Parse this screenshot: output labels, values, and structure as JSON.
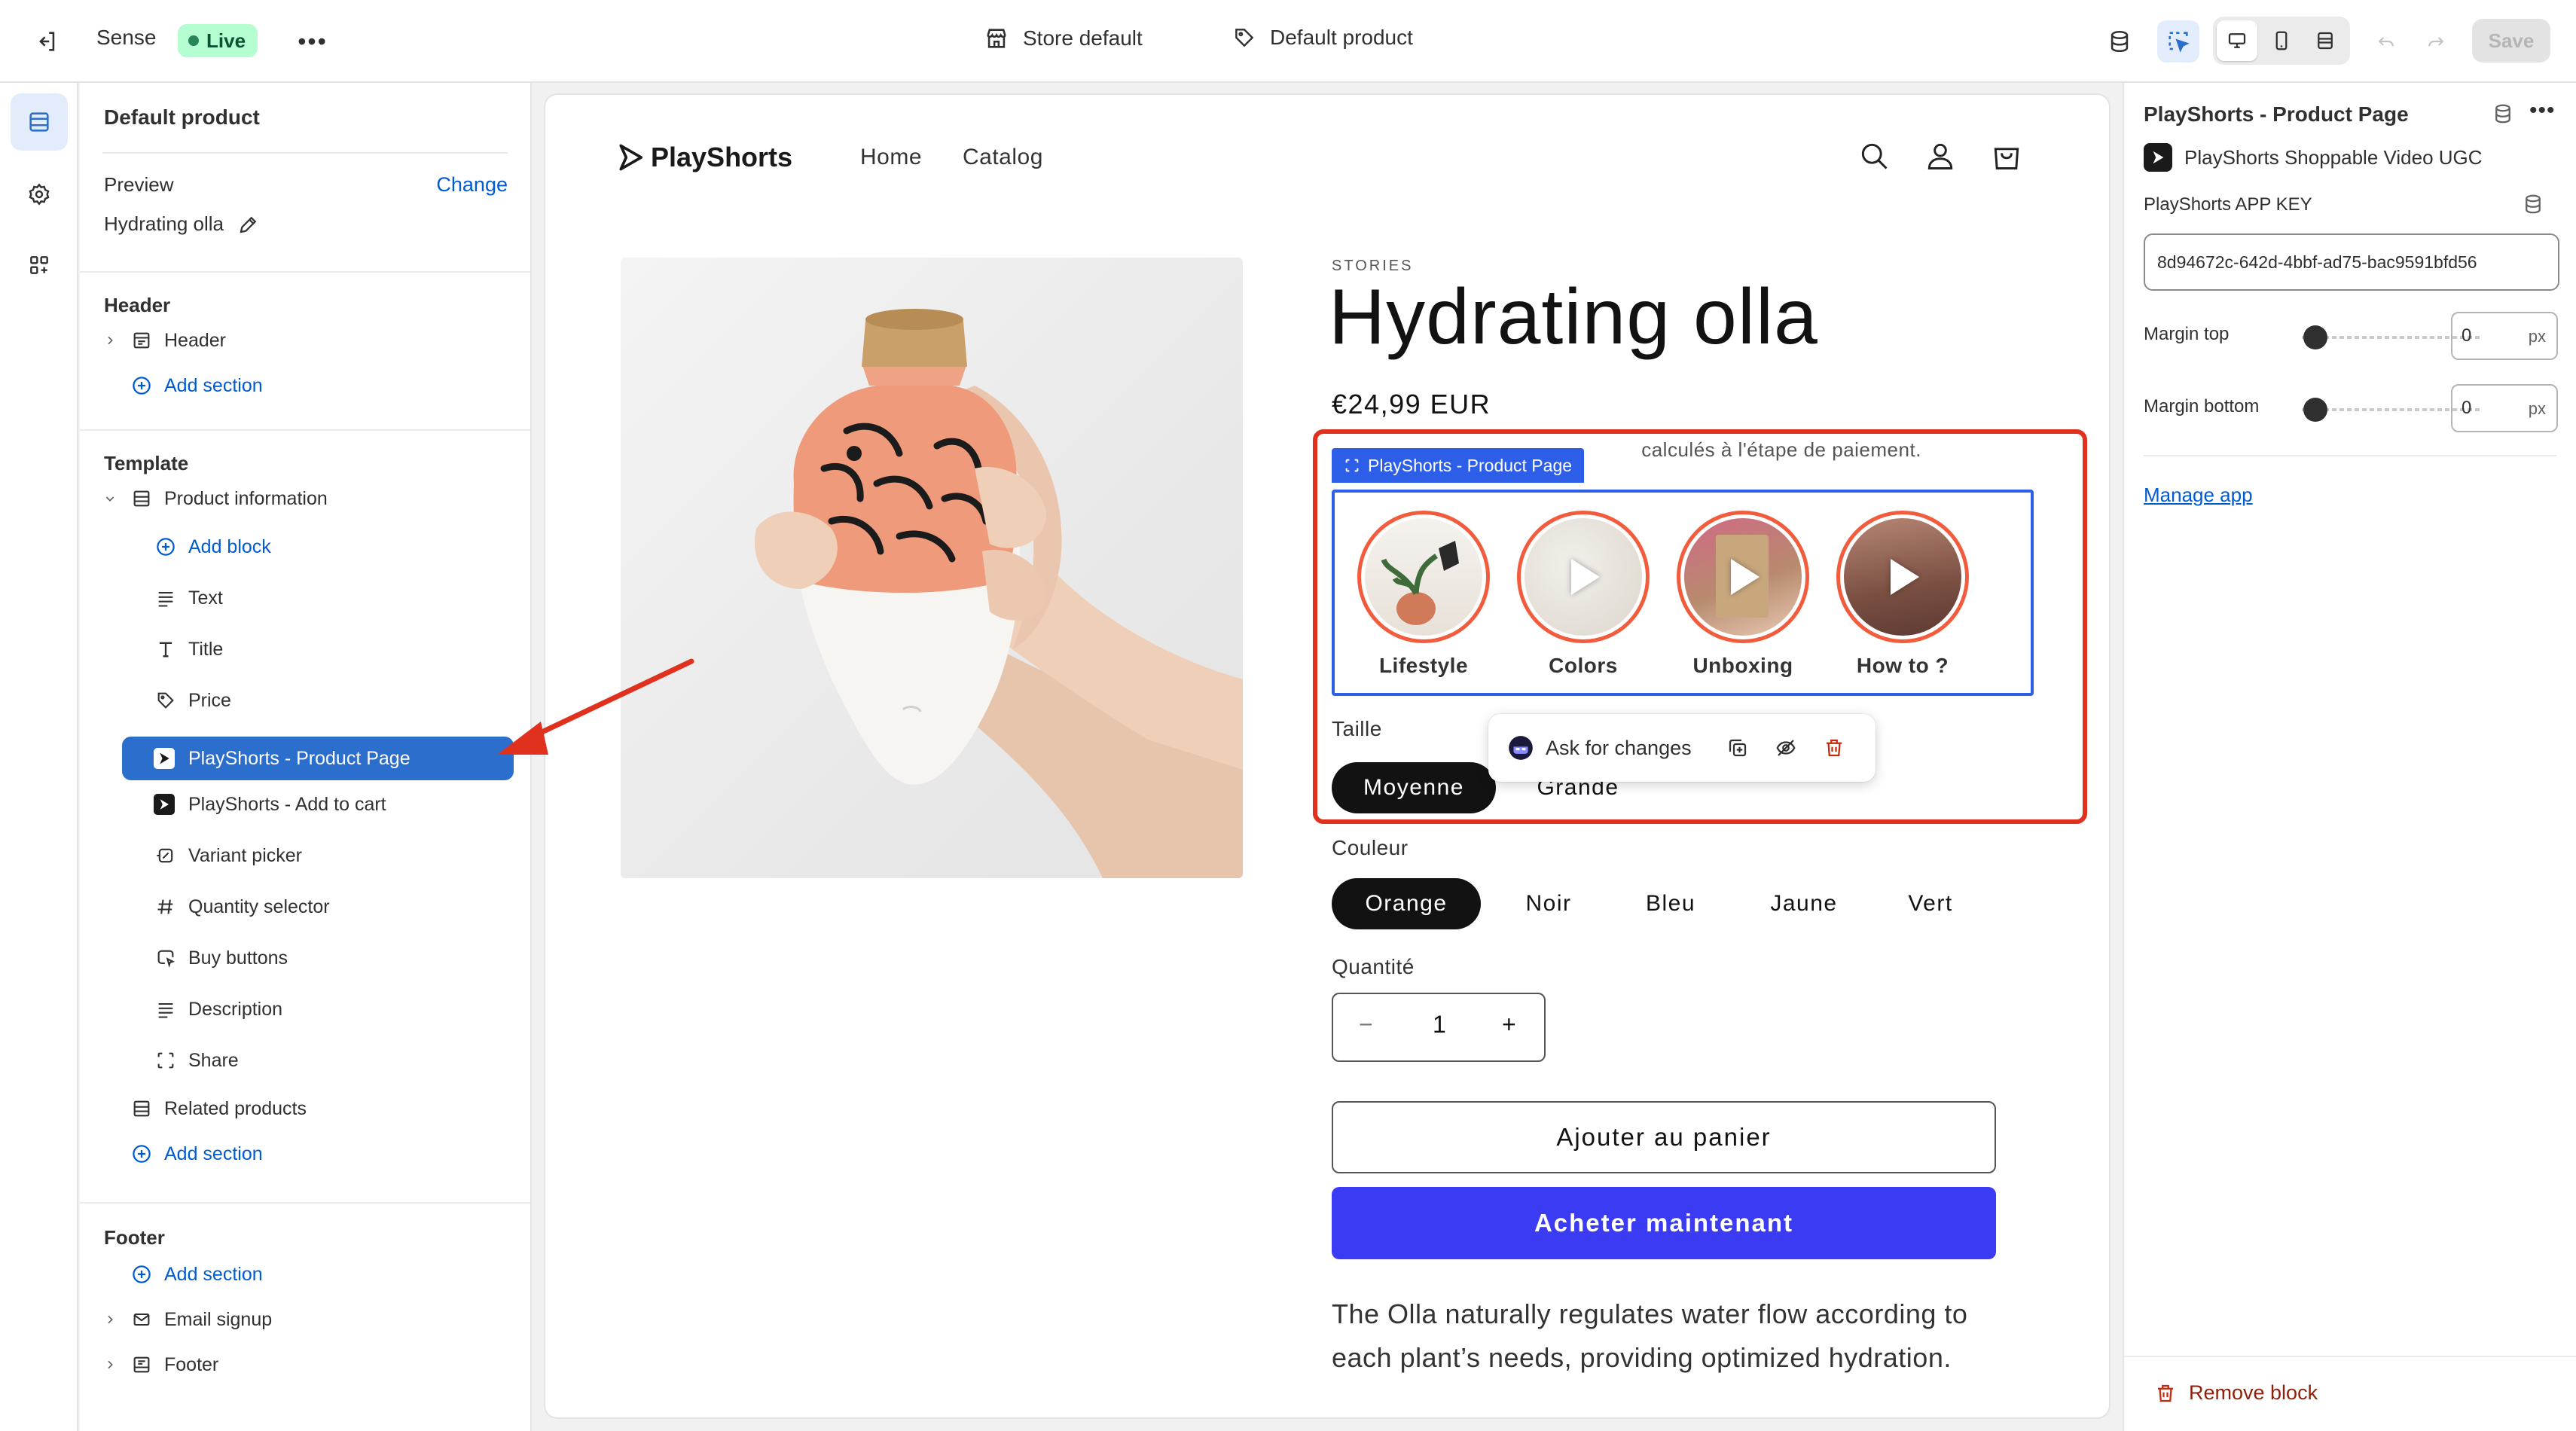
{
  "topbar": {
    "theme_name": "Sense",
    "status": "Live",
    "store_label": "Store default",
    "template_label": "Default product",
    "save_label": "Save"
  },
  "sidebar": {
    "title": "Default product",
    "preview_label": "Preview",
    "change_label": "Change",
    "preview_product": "Hydrating olla",
    "header_group": "Header",
    "header_item": "Header",
    "add_section": "Add section",
    "template_group": "Template",
    "product_information": "Product information",
    "add_block": "Add block",
    "blocks": [
      {
        "label": "Text",
        "icon": "text-icon"
      },
      {
        "label": "Title",
        "icon": "title-icon"
      },
      {
        "label": "Price",
        "icon": "price-tag-icon"
      },
      {
        "label": "PlayShorts - Product Page",
        "icon": "playshorts-app-icon",
        "selected": true
      },
      {
        "label": "PlayShorts - Add to cart",
        "icon": "playshorts-app-icon"
      },
      {
        "label": "Variant picker",
        "icon": "variant-icon"
      },
      {
        "label": "Quantity selector",
        "icon": "hashtag-icon"
      },
      {
        "label": "Buy buttons",
        "icon": "cart-click-icon"
      },
      {
        "label": "Description",
        "icon": "text-icon"
      },
      {
        "label": "Share",
        "icon": "share-icon"
      }
    ],
    "related_products": "Related products",
    "footer_group": "Footer",
    "email_signup": "Email signup",
    "footer_item": "Footer"
  },
  "store": {
    "brand": "PlayShorts",
    "nav": [
      "Home",
      "Catalog"
    ],
    "eyebrow": "STORIES",
    "product_title": "Hydrating olla",
    "price": "€24,99 EUR",
    "taxes_visible_suffix": "calculés à l'étape de paiement.",
    "playshorts_tag": "PlayShorts - Product Page",
    "stories": [
      {
        "label": "Lifestyle",
        "has_play": false
      },
      {
        "label": "Colors",
        "has_play": true
      },
      {
        "label": "Unboxing",
        "has_play": true
      },
      {
        "label": "How to ?",
        "has_play": true
      }
    ],
    "size_label": "Taille",
    "sizes": [
      "Moyenne",
      "Grande"
    ],
    "color_label": "Couleur",
    "colors": [
      "Orange",
      "Noir",
      "Bleu",
      "Jaune",
      "Vert"
    ],
    "quantity_label": "Quantité",
    "quantity_value": "1",
    "add_to_cart": "Ajouter au panier",
    "buy_now": "Acheter maintenant",
    "description": "The Olla naturally regulates water flow according to each plant’s needs, providing optimized hydration.",
    "ask_changes": "Ask for changes"
  },
  "right_panel": {
    "title": "PlayShorts - Product Page",
    "app_name": "PlayShorts Shoppable Video UGC",
    "app_key_label": "PlayShorts APP KEY",
    "app_key_value": "8d94672c-642d-4bbf-ad75-bac9591bfd56",
    "margin_top_label": "Margin top",
    "margin_top_value": "0",
    "margin_bottom_label": "Margin bottom",
    "margin_bottom_value": "0",
    "unit": "px",
    "manage_app": "Manage app",
    "remove_block": "Remove block"
  },
  "colors": {
    "accent_blue": "#2c6ecb",
    "buy_now": "#3b3bf3",
    "highlight_red": "#e0301e",
    "story_ring": "#f25c3d",
    "live_badge": "#b4fed2"
  }
}
